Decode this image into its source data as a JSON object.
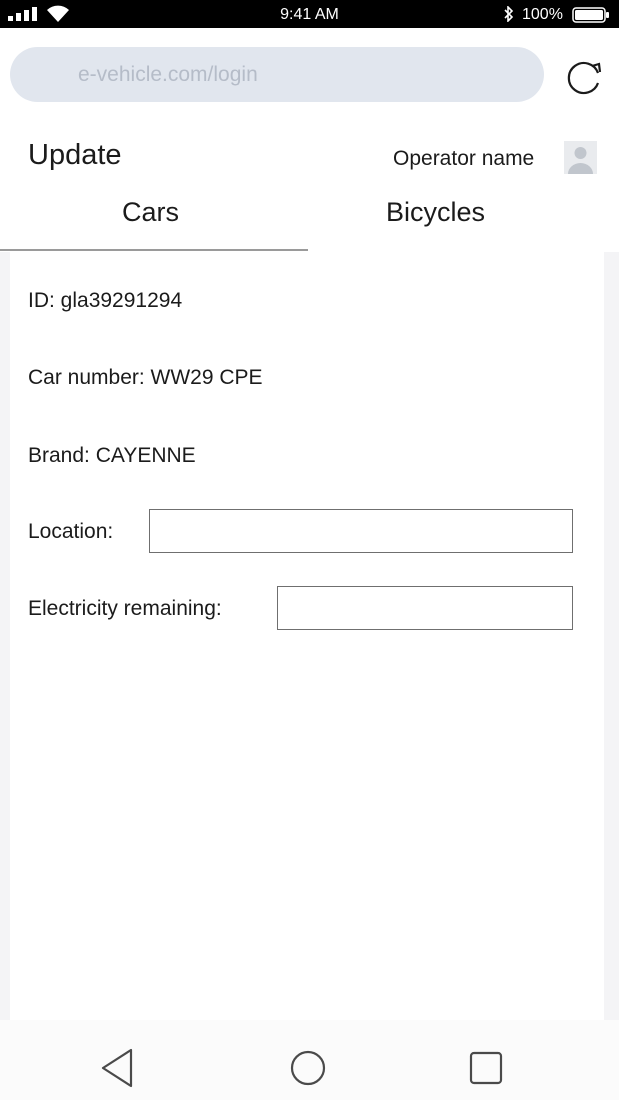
{
  "status_bar": {
    "time": "9:41 AM",
    "battery": "100%"
  },
  "browser": {
    "url": "e-vehicle.com/login"
  },
  "header": {
    "title": "Update",
    "operator": "Operator name"
  },
  "tabs": [
    {
      "label": "Cars",
      "active": true
    },
    {
      "label": "Bicycles",
      "active": false
    }
  ],
  "details": {
    "id": "ID: gla39291294",
    "car_number": "Car number: WW29 CPE",
    "brand": "Brand: CAYENNE",
    "location_label": "Location:",
    "location_value": "",
    "electricity_label": "Electricity remaining:",
    "electricity_value": ""
  },
  "icons": {
    "signal": "signal-icon",
    "wifi": "wifi-icon",
    "bluetooth": "bluetooth-icon",
    "battery": "battery-icon",
    "reload": "reload-icon",
    "avatar": "avatar-icon",
    "back": "back-icon",
    "home": "home-icon",
    "recents": "recents-icon"
  }
}
